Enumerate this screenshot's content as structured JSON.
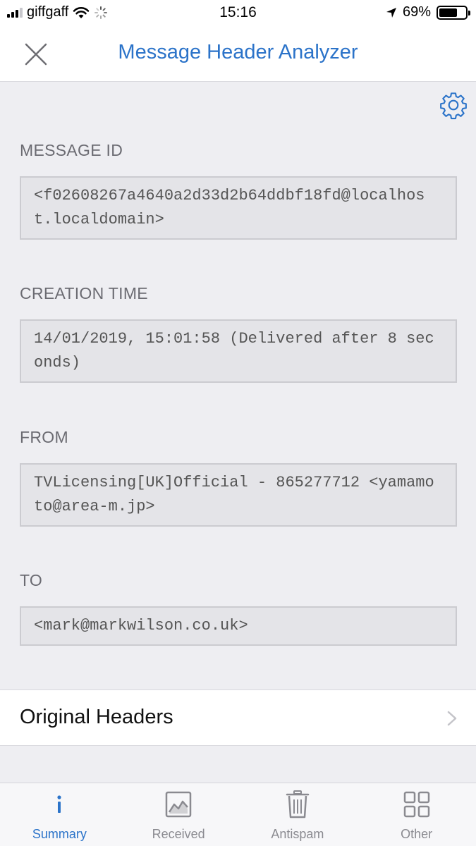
{
  "status_bar": {
    "carrier": "giffgaff",
    "time": "15:16",
    "battery_percent_label": "69%",
    "battery_level": 0.69
  },
  "nav": {
    "title": "Message Header Analyzer",
    "close_icon": "close-icon",
    "settings_icon": "gear-icon"
  },
  "fields": {
    "message_id": {
      "label": "MESSAGE ID",
      "value": "<f02608267a4640a2d33d2b64ddbf18fd@localhost.localdomain>"
    },
    "creation_time": {
      "label": "CREATION TIME",
      "value": "14/01/2019, 15:01:58 (Delivered after 8 seconds)"
    },
    "from": {
      "label": "FROM",
      "value": "TVLicensing[UK]Official - 865277712 <yamamoto@area-m.jp>"
    },
    "to": {
      "label": "TO",
      "value": "<mark@markwilson.co.uk>"
    }
  },
  "original_headers": {
    "label": "Original Headers"
  },
  "tabs": [
    {
      "label": "Summary",
      "icon": "info-icon",
      "active": true
    },
    {
      "label": "Received",
      "icon": "chart-icon",
      "active": false
    },
    {
      "label": "Antispam",
      "icon": "trash-icon",
      "active": false
    },
    {
      "label": "Other",
      "icon": "grid-icon",
      "active": false
    }
  ],
  "colors": {
    "accent": "#2b73c9",
    "background": "#eeeef2",
    "field_background": "#e4e4e8"
  }
}
